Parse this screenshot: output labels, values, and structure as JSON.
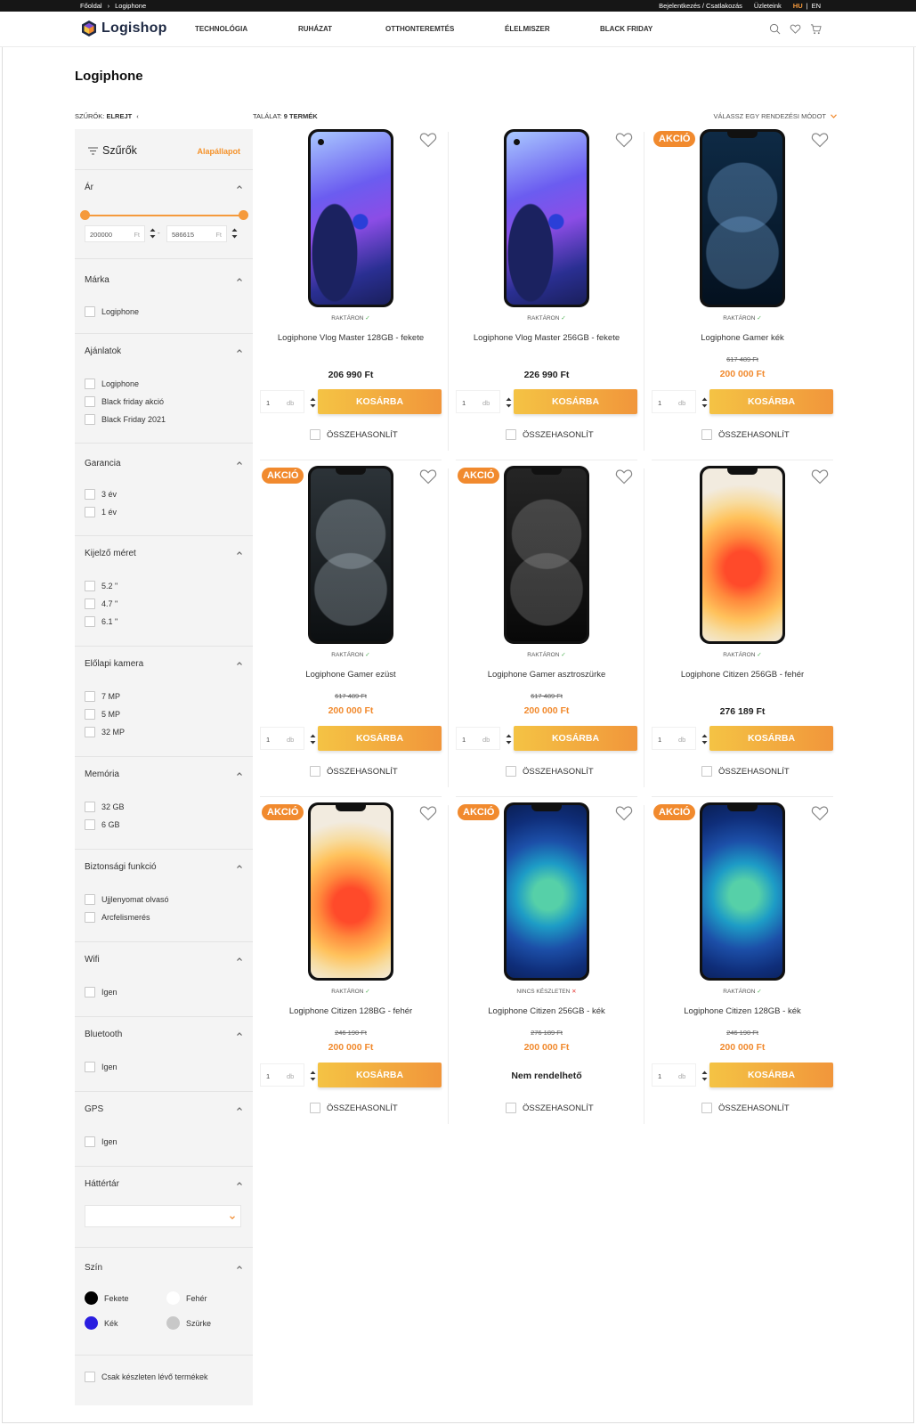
{
  "topbar": {
    "breadcrumb": [
      "Főoldal",
      "Logiphone"
    ],
    "login": "Bejelentkezés / Csatlakozás",
    "stores": "Üzleteink",
    "lang_hu": "HU",
    "lang_sep": "|",
    "lang_en": "EN"
  },
  "header": {
    "logo": "Logishop",
    "nav": [
      "TECHNOLÓGIA",
      "RUHÁZAT",
      "OTTHONTEREMTÉS",
      "ÉLELMISZER",
      "BLACK FRIDAY"
    ]
  },
  "page": {
    "title": "Logiphone",
    "filters_label": "SZŰRŐK:",
    "filters_hide": "ELREJT",
    "results_label": "TALÁLAT:",
    "results_count": "9 TERMÉK",
    "sort_label": "VÁLASSZ EGY RENDEZÉSI MÓDOT"
  },
  "sidebar": {
    "title": "Szűrők",
    "reset": "Alapállapot",
    "price": {
      "title": "Ár",
      "min": "200000",
      "max": "586615",
      "unit": "Ft",
      "separator": "-"
    },
    "brand": {
      "title": "Márka",
      "options": [
        "Logiphone"
      ]
    },
    "offers": {
      "title": "Ajánlatok",
      "options": [
        "Logiphone",
        "Black friday akció",
        "Black Friday 2021"
      ]
    },
    "warranty": {
      "title": "Garancia",
      "options": [
        "3 év",
        "1 év"
      ]
    },
    "display": {
      "title": "Kijelző méret",
      "options": [
        "5.2 \"",
        "4.7 \"",
        "6.1 \""
      ]
    },
    "camera": {
      "title": "Előlapi kamera",
      "options": [
        "7 MP",
        "5 MP",
        "32 MP"
      ]
    },
    "memory": {
      "title": "Memória",
      "options": [
        "32 GB",
        "6 GB"
      ]
    },
    "security": {
      "title": "Biztonsági funkció",
      "options": [
        "Ujjlenyomat olvasó",
        "Arcfelismerés"
      ]
    },
    "wifi": {
      "title": "Wifi",
      "options": [
        "Igen"
      ]
    },
    "bluetooth": {
      "title": "Bluetooth",
      "options": [
        "Igen"
      ]
    },
    "gps": {
      "title": "GPS",
      "options": [
        "Igen"
      ]
    },
    "storage": {
      "title": "Háttértár"
    },
    "color": {
      "title": "Szín",
      "options": [
        {
          "label": "Fekete",
          "color": "#000000"
        },
        {
          "label": "Fehér",
          "color": "#ffffff"
        },
        {
          "label": "Kék",
          "color": "#2a1ee0"
        },
        {
          "label": "Szürke",
          "color": "#c8c8c8"
        }
      ]
    },
    "in_stock_only": "Csak készleten lévő termékek"
  },
  "products": [
    {
      "name": "Logiphone Vlog Master 128GB - fekete",
      "stock": "RAKTÁRON",
      "in_stock": true,
      "sale": false,
      "price": "206 990 Ft",
      "old_price": "",
      "qty": "1",
      "qty_unit": "db",
      "cart": "KOSÁRBA",
      "compare": "ÖSSZEHASONLÍT",
      "style": "android"
    },
    {
      "name": "Logiphone Vlog Master 256GB - fekete",
      "stock": "RAKTÁRON",
      "in_stock": true,
      "sale": false,
      "price": "226 990 Ft",
      "old_price": "",
      "qty": "1",
      "qty_unit": "db",
      "cart": "KOSÁRBA",
      "compare": "ÖSSZEHASONLÍT",
      "style": "android"
    },
    {
      "name": "Logiphone Gamer kék",
      "stock": "RAKTÁRON",
      "in_stock": true,
      "sale": true,
      "badge": "AKCIÓ",
      "price": "200 000 Ft",
      "old_price": "617 489 Ft",
      "qty": "1",
      "qty_unit": "db",
      "cart": "KOSÁRBA",
      "compare": "ÖSSZEHASONLÍT",
      "style": "pro-blue"
    },
    {
      "name": "Logiphone Gamer ezüst",
      "stock": "RAKTÁRON",
      "in_stock": true,
      "sale": true,
      "badge": "AKCIÓ",
      "price": "200 000 Ft",
      "old_price": "617 489 Ft",
      "qty": "1",
      "qty_unit": "db",
      "cart": "KOSÁRBA",
      "compare": "ÖSSZEHASONLÍT",
      "style": "pro-silver"
    },
    {
      "name": "Logiphone Gamer asztroszürke",
      "stock": "RAKTÁRON",
      "in_stock": true,
      "sale": true,
      "badge": "AKCIÓ",
      "price": "200 000 Ft",
      "old_price": "617 489 Ft",
      "qty": "1",
      "qty_unit": "db",
      "cart": "KOSÁRBA",
      "compare": "ÖSSZEHASONLÍT",
      "style": "pro-graphite"
    },
    {
      "name": "Logiphone Citizen 256GB - fehér",
      "stock": "RAKTÁRON",
      "in_stock": true,
      "sale": false,
      "price": "276 189 Ft",
      "old_price": "",
      "qty": "1",
      "qty_unit": "db",
      "cart": "KOSÁRBA",
      "compare": "ÖSSZEHASONLÍT",
      "style": "white"
    },
    {
      "name": "Logiphone Citizen 128BG - fehér",
      "stock": "RAKTÁRON",
      "in_stock": true,
      "sale": true,
      "badge": "AKCIÓ",
      "price": "200 000 Ft",
      "old_price": "246 190 Ft",
      "qty": "1",
      "qty_unit": "db",
      "cart": "KOSÁRBA",
      "compare": "ÖSSZEHASONLÍT",
      "style": "white"
    },
    {
      "name": "Logiphone Citizen 256GB - kék",
      "stock": "NINCS KÉSZLETEN",
      "in_stock": false,
      "sale": true,
      "badge": "AKCIÓ",
      "price": "200 000 Ft",
      "old_price": "276 189 Ft",
      "unavailable": "Nem rendelhető",
      "compare": "ÖSSZEHASONLÍT",
      "style": "blue"
    },
    {
      "name": "Logiphone Citizen 128GB - kék",
      "stock": "RAKTÁRON",
      "in_stock": true,
      "sale": true,
      "badge": "AKCIÓ",
      "price": "200 000 Ft",
      "old_price": "246 190 Ft",
      "qty": "1",
      "qty_unit": "db",
      "cart": "KOSÁRBA",
      "compare": "ÖSSZEHASONLÍT",
      "style": "blue"
    }
  ],
  "colors": {
    "accent": "#f18a2e",
    "button_start": "#f4c344",
    "button_end": "#f1963b",
    "topbar": "#161616"
  }
}
